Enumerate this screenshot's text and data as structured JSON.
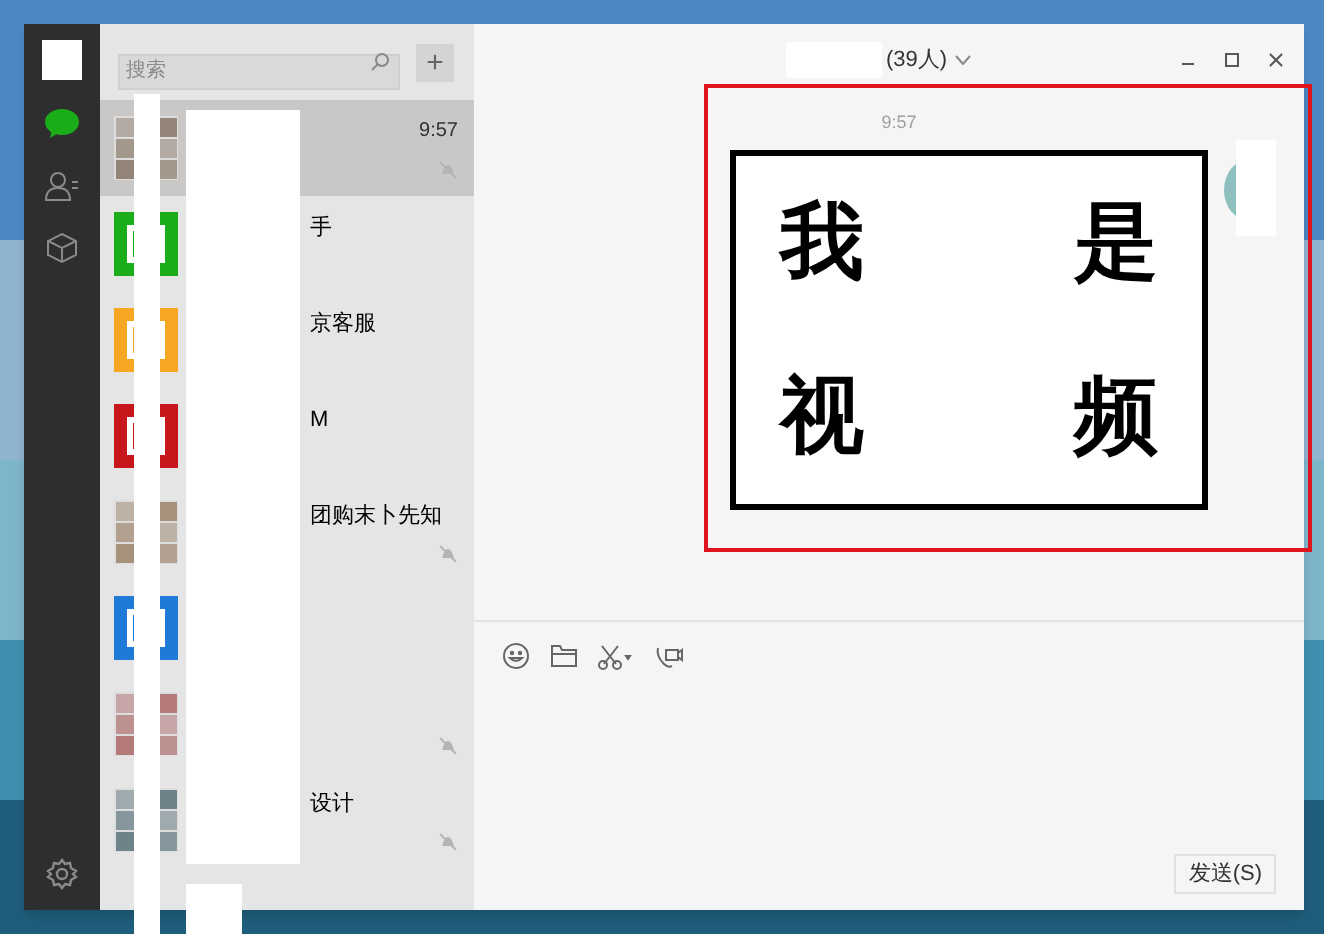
{
  "search": {
    "placeholder": "搜索"
  },
  "add_button": "+",
  "chats": [
    {
      "time": "9:57",
      "muted": true,
      "selected": true,
      "avatar": {
        "kind": "grid",
        "color": "#8a7a6a"
      }
    },
    {
      "name": "手",
      "muted": false,
      "selected": false,
      "avatar": {
        "kind": "solid",
        "color": "#1aad19"
      }
    },
    {
      "name": "京客服",
      "muted": false,
      "selected": false,
      "avatar": {
        "kind": "solid",
        "color": "#f5a623"
      }
    },
    {
      "name": "M",
      "muted": false,
      "selected": false,
      "avatar": {
        "kind": "solid",
        "color": "#c8161d"
      }
    },
    {
      "name": "团购末卜先知",
      "muted": true,
      "selected": false,
      "avatar": {
        "kind": "grid",
        "color": "#a08870"
      }
    },
    {
      "muted": false,
      "selected": false,
      "avatar": {
        "kind": "solid",
        "color": "#1e7ad6"
      }
    },
    {
      "muted": true,
      "selected": false,
      "avatar": {
        "kind": "grid",
        "color": "#b07070"
      }
    },
    {
      "name": "设计",
      "muted": true,
      "selected": false,
      "avatar": {
        "kind": "grid",
        "color": "#607880"
      }
    }
  ],
  "chat": {
    "title": "(39人)",
    "message_time": "9:57",
    "image_text": [
      "我",
      "是",
      "视",
      "频"
    ]
  },
  "send_button": "发送(S)"
}
